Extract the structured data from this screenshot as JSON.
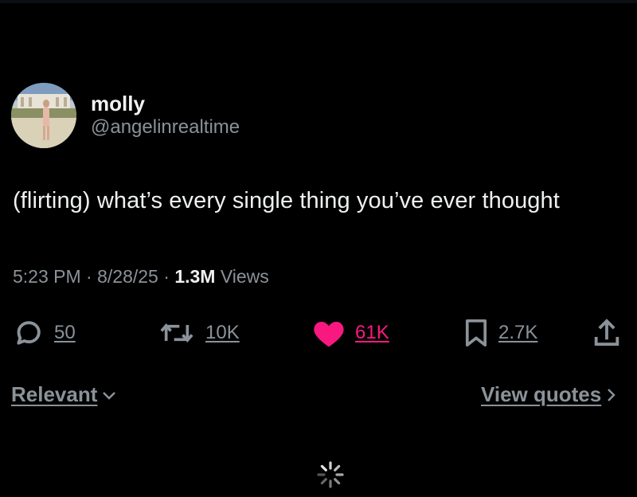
{
  "tweet": {
    "author": {
      "display_name": "molly",
      "handle": "@angelinrealtime"
    },
    "text": "(flirting) what’s every single thing you’ve ever thought",
    "meta": {
      "time": "5:23 PM",
      "date": "8/28/25",
      "views_count": "1.3M",
      "views_label": "Views",
      "separator": "·"
    },
    "actions": {
      "replies": "50",
      "retweets": "10K",
      "likes": "61K",
      "bookmarks": "2.7K"
    }
  },
  "footer": {
    "sort_label": "Relevant",
    "view_quotes_label": "View quotes"
  },
  "icons": {
    "reply": "speech-bubble-icon",
    "retweet": "retweet-icon",
    "like": "heart-icon",
    "bookmark": "bookmark-icon",
    "share": "share-icon",
    "sort": "chevron-down-icon",
    "view_quotes": "chevron-right-icon",
    "loading": "loading-spinner-icon"
  },
  "colors": {
    "background": "#000000",
    "like_active": "#f91880",
    "secondary_text": "#8b9299"
  }
}
